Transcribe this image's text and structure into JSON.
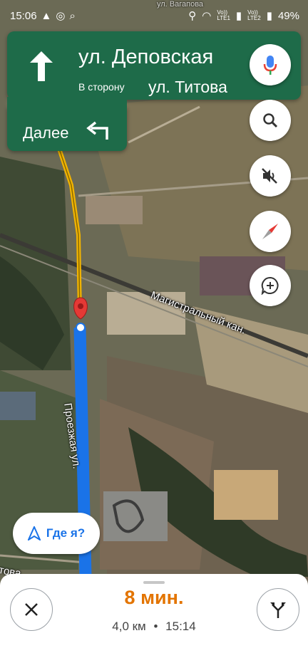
{
  "status_bar": {
    "time": "15:06",
    "network_1": "Vo))",
    "network_1_sub": "LTE1",
    "network_2": "Vo))",
    "network_2_sub": "LTE2",
    "battery": "49%"
  },
  "navigation": {
    "street": "ул. Деповская",
    "toward_prefix": "В сторону",
    "toward_street": "ул. Титова",
    "next_label": "Далее"
  },
  "map_labels": {
    "canal": "Магистральный кан.",
    "road": "Проезжая ул.",
    "partial_road": "това",
    "top_partial": "ул. Вагапова"
  },
  "buttons": {
    "where_am_i": "Где я?"
  },
  "trip": {
    "eta": "8 мин.",
    "distance": "4,0 км",
    "separator": "•",
    "arrival": "15:14"
  },
  "colors": {
    "nav_green": "#1e6b49",
    "route_blue": "#1a73e8",
    "eta_orange": "#e37400"
  }
}
